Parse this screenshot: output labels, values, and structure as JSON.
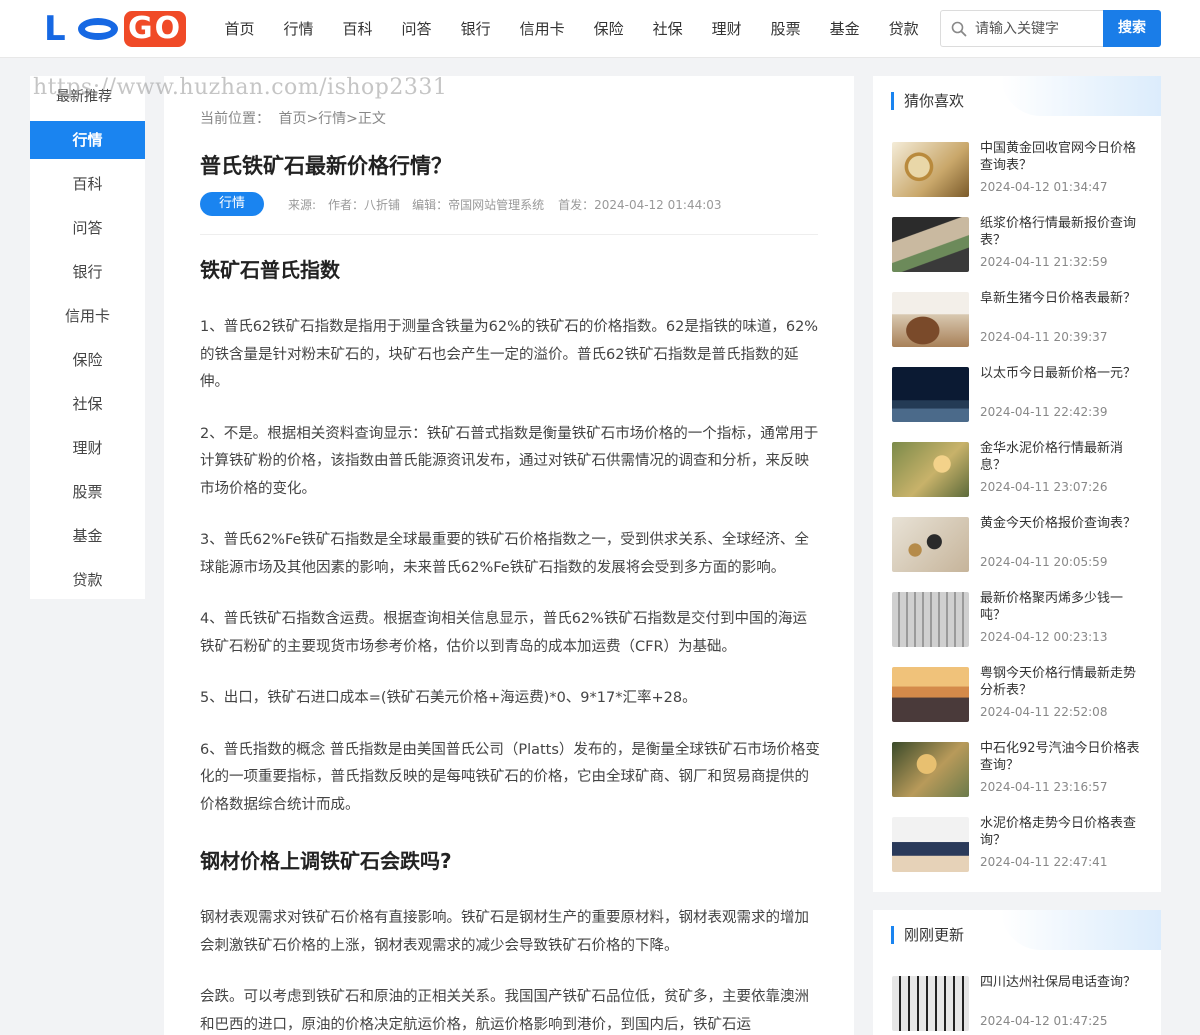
{
  "header": {
    "logo_text": "LOGO",
    "nav": [
      "首页",
      "行情",
      "百科",
      "问答",
      "银行",
      "信用卡",
      "保险",
      "社保",
      "理财",
      "股票",
      "基金",
      "贷款"
    ],
    "search_placeholder": "请输入关键字",
    "search_button": "搜索"
  },
  "watermark": "https://www.huzhan.com/ishop2331",
  "leftbar": {
    "title": "最新推荐",
    "items": [
      "行情",
      "百科",
      "问答",
      "银行",
      "信用卡",
      "保险",
      "社保",
      "理财",
      "股票",
      "基金",
      "贷款"
    ],
    "active_index": 0
  },
  "article": {
    "breadcrumb_label": "当前位置：",
    "breadcrumb_path": "首页>行情>正文",
    "title": "普氏铁矿石最新价格行情？",
    "tag": "行情",
    "source": "来源:",
    "author": "作者：八折铺",
    "editor": "编辑：帝国网站管理系统",
    "published": "首发：2024-04-12 01:44:03",
    "sections": [
      {
        "heading": "铁矿石普氏指数",
        "paragraphs": [
          "1、普氏62铁矿石指数是指用于测量含铁量为62%的铁矿石的价格指数。62是指铁的味道，62%的铁含量是针对粉末矿石的，块矿石也会产生一定的溢价。普氏62铁矿石指数是普氏指数的延伸。",
          "2、不是。根据相关资料查询显示：铁矿石普式指数是衡量铁矿石市场价格的一个指标，通常用于计算铁矿粉的价格，该指数由普氏能源资讯发布，通过对铁矿石供需情况的调查和分析，来反映市场价格的变化。",
          "3、普氏62%Fe铁矿石指数是全球最重要的铁矿石价格指数之一，受到供求关系、全球经济、全球能源市场及其他因素的影响，未来普氏62%Fe铁矿石指数的发展将会受到多方面的影响。",
          "4、普氏铁矿石指数含运费。根据查询相关信息显示，普氏62%铁矿石指数是交付到中国的海运铁矿石粉矿的主要现货市场参考价格，估价以到青岛的成本加运费（CFR）为基础。",
          "5、出口，铁矿石进口成本=(铁矿石美元价格+海运费)*0、9*17*汇率+28。",
          "6、普氏指数的概念 普氏指数是由美国普氏公司（Platts）发布的，是衡量全球铁矿石市场价格变化的一项重要指标，普氏指数反映的是每吨铁矿石的价格，它由全球矿商、钢厂和贸易商提供的价格数据综合统计而成。"
        ]
      },
      {
        "heading": "钢材价格上调铁矿石会跌吗?",
        "paragraphs": [
          "钢材表观需求对铁矿石价格有直接影响。铁矿石是钢材生产的重要原材料，钢材表观需求的增加会刺激铁矿石价格的上涨，钢材表观需求的减少会导致铁矿石价格的下降。",
          "会跌。可以考虑到铁矿石和原油的正相关关系。我国国产铁矿石品位低，贫矿多，主要依靠澳洲和巴西的进口，原油的价格决定航运价格，航运价格影响到港价，到国内后，铁矿石运"
        ]
      }
    ]
  },
  "guess": {
    "title": "猜你喜欢",
    "items": [
      {
        "title": "中国黄金回收官网今日价格查询表？",
        "date": "2024-04-12 01:34:47",
        "thumb": "clock-money"
      },
      {
        "title": "纸浆价格行情最新报价查询表？",
        "date": "2024-04-11 21:32:59",
        "thumb": "cash-hands"
      },
      {
        "title": "阜新生猪今日价格表最新？",
        "date": "2024-04-11 20:39:37",
        "thumb": "wallet"
      },
      {
        "title": "以太币今日最新价格一元？",
        "date": "2024-04-11 22:42:39",
        "thumb": "night-sky"
      },
      {
        "title": "金华水泥价格行情最新消息？",
        "date": "2024-04-11 23:07:26",
        "thumb": "cartoon-coins"
      },
      {
        "title": "黄金今天价格报价查询表？",
        "date": "2024-04-11 20:05:59",
        "thumb": "coins-wallet"
      },
      {
        "title": "最新价格聚丙烯多少钱一吨？",
        "date": "2024-04-12 00:23:13",
        "thumb": "calculator"
      },
      {
        "title": "粤钢今天价格行情最新走势分析表？",
        "date": "2024-04-11 22:52:08",
        "thumb": "city-sunset"
      },
      {
        "title": "中石化92号汽油今日价格表查询？",
        "date": "2024-04-11 23:16:57",
        "thumb": "house-money"
      },
      {
        "title": "水泥价格走势今日价格表查询？",
        "date": "2024-04-11 22:47:41",
        "thumb": "people-office"
      }
    ]
  },
  "latest": {
    "title": "刚刚更新",
    "items": [
      {
        "title": "四川达州社保局电话查询？",
        "date": "2024-04-12 01:47:25",
        "thumb": "calculator-keys"
      }
    ]
  },
  "colors": {
    "accent": "#1a84f0",
    "logo_blue": "#1668e3",
    "logo_orange": "#f04a27"
  }
}
